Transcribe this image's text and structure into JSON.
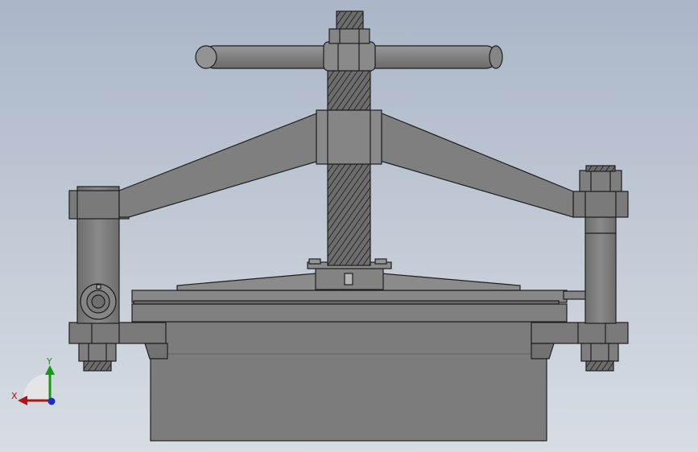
{
  "viewport": {
    "background_top": "#aab6c8",
    "background_bottom": "#d8dde3",
    "part_color": "#7c7c7c",
    "edge_color": "#1e1e1e"
  },
  "triad": {
    "x_label": "X",
    "y_label": "Y",
    "x_color": "#b01515",
    "y_color": "#129a12",
    "z_color": "#1a2fbf"
  }
}
